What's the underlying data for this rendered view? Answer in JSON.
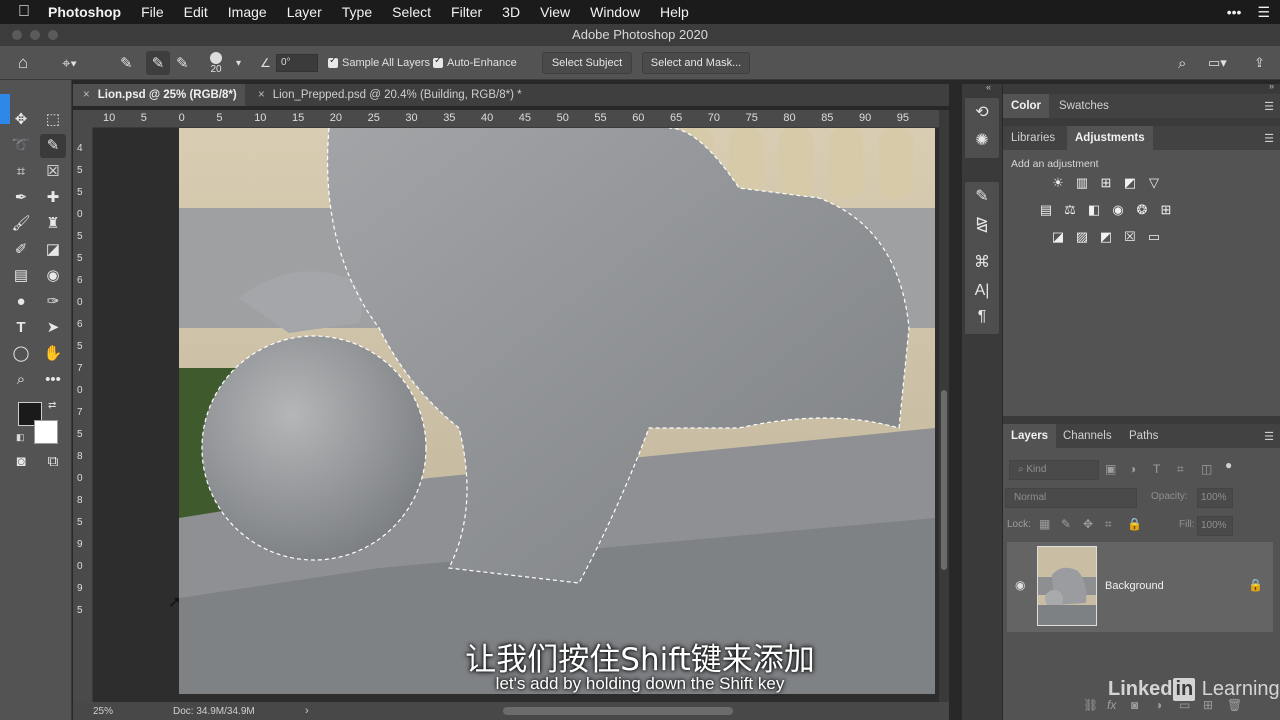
{
  "menubar": {
    "apple_icon": "",
    "app_name": "Photoshop",
    "menus": [
      "File",
      "Edit",
      "Image",
      "Layer",
      "Type",
      "Select",
      "Filter",
      "3D",
      "View",
      "Window",
      "Help"
    ]
  },
  "window": {
    "title": "Adobe Photoshop 2020"
  },
  "options_bar": {
    "brush_size": "20",
    "angle": "0°",
    "sample_all_layers": "Sample All Layers",
    "auto_enhance": "Auto-Enhance",
    "select_subject": "Select Subject",
    "select_and_mask": "Select and Mask..."
  },
  "documents": {
    "tabs": [
      {
        "label": "Lion.psd @ 25% (RGB/8*)",
        "active": true
      },
      {
        "label": "Lion_Prepped.psd @ 20.4% (Building, RGB/8*) *",
        "active": false
      }
    ]
  },
  "rulers": {
    "top": [
      "10",
      "5",
      "0",
      "5",
      "10",
      "15",
      "20",
      "25",
      "30",
      "35",
      "40",
      "45",
      "50",
      "55",
      "60",
      "65",
      "70",
      "75",
      "80",
      "85",
      "90",
      "95"
    ],
    "left": [
      "4",
      "5",
      "5",
      "0",
      "5",
      "5",
      "6",
      "0",
      "6",
      "5",
      "7",
      "0",
      "7",
      "5",
      "8",
      "0",
      "8",
      "5",
      "9",
      "0",
      "9",
      "5"
    ]
  },
  "statusbar": {
    "zoom": "25%",
    "doc": "Doc: 34.9M/34.9M",
    "arrow": "›"
  },
  "panels": {
    "color_tabs": [
      "Color",
      "Swatches"
    ],
    "adjust_tabs": [
      "Libraries",
      "Adjustments"
    ],
    "add_adjustment": "Add an adjustment",
    "layers_tabs": [
      "Layers",
      "Channels",
      "Paths"
    ],
    "kind_filter": "Kind",
    "blend_mode": "Normal",
    "opacity_label": "Opacity:",
    "opacity_value": "100%",
    "lock_label": "Lock:",
    "fill_label": "Fill:",
    "fill_value": "100%",
    "layer_name": "Background"
  },
  "subtitles": {
    "chinese": "让我们按住Shift键来添加",
    "english": "let's add by holding down the Shift key"
  },
  "watermark": {
    "linked": "Linked",
    "in": "in",
    "learning": "Learning"
  },
  "colors": {
    "accent": "#2e88e8",
    "panel": "#535353",
    "background": "#282828"
  }
}
